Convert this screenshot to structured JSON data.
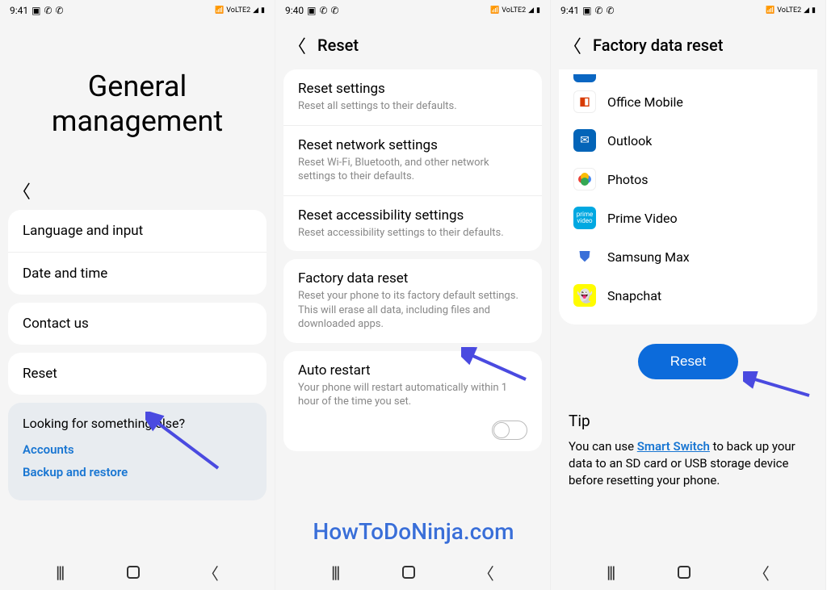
{
  "watermark": "HowToDoNinja.com",
  "screen1": {
    "status_time": "9:41",
    "header": "General management",
    "items": [
      "Language and input",
      "Date and time",
      "Contact us",
      "Reset"
    ],
    "footer_q": "Looking for something else?",
    "footer_links": [
      "Accounts",
      "Backup and restore"
    ]
  },
  "screen2": {
    "status_time": "9:40",
    "title": "Reset",
    "settings": [
      {
        "t": "Reset settings",
        "d": "Reset all settings to their defaults."
      },
      {
        "t": "Reset network settings",
        "d": "Reset Wi-Fi, Bluetooth, and other network settings to their defaults."
      },
      {
        "t": "Reset accessibility settings",
        "d": "Reset accessibility settings to their defaults."
      },
      {
        "t": "Factory data reset",
        "d": "Reset your phone to its factory default settings. This will erase all data, including files and downloaded apps."
      },
      {
        "t": "Auto restart",
        "d": "Your phone will restart automatically within 1 hour of the time you set."
      }
    ]
  },
  "screen3": {
    "status_time": "9:41",
    "title": "Factory data reset",
    "apps": [
      {
        "name": "Office Mobile",
        "icon": "office-icon"
      },
      {
        "name": "Outlook",
        "icon": "outlook-icon"
      },
      {
        "name": "Photos",
        "icon": "photos-icon"
      },
      {
        "name": "Prime Video",
        "icon": "prime-video-icon"
      },
      {
        "name": "Samsung Max",
        "icon": "samsung-max-icon"
      },
      {
        "name": "Snapchat",
        "icon": "snapchat-icon"
      }
    ],
    "reset_button": "Reset",
    "tip_title": "Tip",
    "tip_before": "You can use ",
    "tip_link": "Smart Switch",
    "tip_after": " to back up your data to an SD card or USB storage device before resetting your phone."
  },
  "status_icons": {
    "net_label": "VoLTE2",
    "signal": "▲",
    "battery": "▮"
  }
}
